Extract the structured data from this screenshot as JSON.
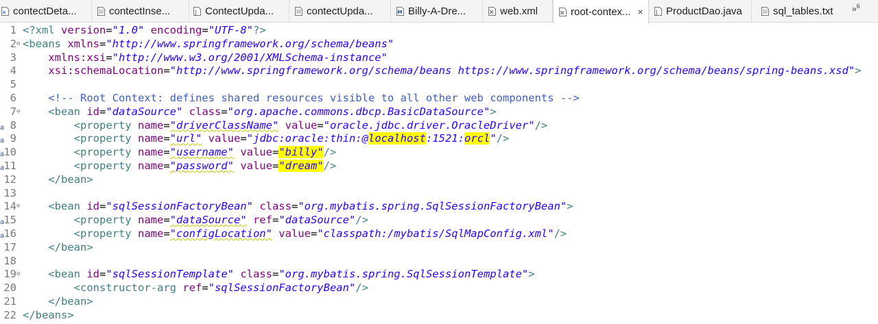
{
  "tabs": [
    {
      "label": "contectDeta...",
      "icon": "xml-file-icon",
      "active": false
    },
    {
      "label": "contectInse...",
      "icon": "text-file-icon",
      "active": false
    },
    {
      "label": "ContectUpda...",
      "icon": "java-file-icon",
      "active": false
    },
    {
      "label": "contectUpda...",
      "icon": "text-file-icon",
      "active": false
    },
    {
      "label": "Billy-A-Dre...",
      "icon": "manifest-file-icon",
      "active": false
    },
    {
      "label": "web.xml",
      "icon": "xml-file-icon",
      "active": false
    },
    {
      "label": "root-contex...",
      "icon": "xml-file-icon",
      "active": true
    },
    {
      "label": "ProductDao.java",
      "icon": "java-file-icon",
      "active": false
    },
    {
      "label": "sql_tables.txt",
      "icon": "text-file-icon",
      "active": false
    }
  ],
  "tab_close": "×",
  "overflow": {
    "arrows": "»",
    "count": "6"
  },
  "lines": [
    {
      "n": "1",
      "fold": "",
      "mark": "",
      "tokens": [
        [
          "pi",
          "<?xml "
        ],
        [
          "at",
          "version"
        ],
        [
          "",
          "="
        ],
        [
          "st",
          "\"1.0\""
        ],
        [
          "at",
          " encoding"
        ],
        [
          "",
          "="
        ],
        [
          "st",
          "\"UTF-8\""
        ],
        [
          "pi",
          "?>"
        ]
      ]
    },
    {
      "n": "2",
      "fold": "⊖",
      "mark": "",
      "tokens": [
        [
          "tg",
          "<beans "
        ],
        [
          "at",
          "xmlns"
        ],
        [
          "",
          "="
        ],
        [
          "st",
          "\"http://www.springframework.org/schema/beans\""
        ]
      ]
    },
    {
      "n": "3",
      "fold": "",
      "mark": "",
      "tokens": [
        [
          "at",
          "    xmlns:xsi"
        ],
        [
          "",
          "="
        ],
        [
          "st",
          "\"http://www.w3.org/2001/XMLSchema-instance\""
        ]
      ]
    },
    {
      "n": "4",
      "fold": "",
      "mark": "",
      "tokens": [
        [
          "at",
          "    xsi:schemaLocation"
        ],
        [
          "",
          "="
        ],
        [
          "st",
          "\"http://www.springframework.org/schema/beans https://www.springframework.org/schema/beans/spring-beans.xsd\""
        ],
        [
          "tg",
          ">"
        ]
      ]
    },
    {
      "n": "5",
      "fold": "",
      "mark": "",
      "tokens": []
    },
    {
      "n": "6",
      "fold": "",
      "mark": "",
      "tokens": [
        [
          "cm",
          "    <!-- Root Context: defines shared resources visible to all other web components -->"
        ]
      ]
    },
    {
      "n": "7",
      "fold": "⊖",
      "mark": "",
      "tokens": [
        [
          "tg",
          "    <bean "
        ],
        [
          "at",
          "id"
        ],
        [
          "",
          "="
        ],
        [
          "st",
          "\"dataSource\""
        ],
        [
          "at",
          " class"
        ],
        [
          "",
          "="
        ],
        [
          "st",
          "\"org.apache.commons.dbcp.BasicDataSource\""
        ],
        [
          "tg",
          ">"
        ]
      ]
    },
    {
      "n": "8",
      "fold": "",
      "mark": "a",
      "tokens": [
        [
          "tg",
          "        <property "
        ],
        [
          "at",
          "name"
        ],
        [
          "",
          "="
        ],
        [
          "st sq",
          "\"driverClassName\""
        ],
        [
          "at",
          " value"
        ],
        [
          "",
          "="
        ],
        [
          "st",
          "\"oracle.jdbc.driver.OracleDriver\""
        ],
        [
          "tg",
          "/>"
        ]
      ]
    },
    {
      "n": "9",
      "fold": "",
      "mark": "a",
      "tokens": [
        [
          "tg",
          "        <property "
        ],
        [
          "at",
          "name"
        ],
        [
          "",
          "="
        ],
        [
          "st sq",
          "\"url\""
        ],
        [
          "at",
          " value"
        ],
        [
          "",
          "="
        ],
        [
          "st",
          "\"jdbc:oracle:thin:@"
        ],
        [
          "st hl",
          "localhost"
        ],
        [
          "st",
          ":1521:"
        ],
        [
          "st hl",
          "orcl"
        ],
        [
          "st",
          "\""
        ],
        [
          "tg",
          "/>"
        ]
      ]
    },
    {
      "n": "10",
      "fold": "",
      "mark": "a",
      "tokens": [
        [
          "tg",
          "        <property "
        ],
        [
          "at",
          "name"
        ],
        [
          "",
          "="
        ],
        [
          "st sq",
          "\"username\""
        ],
        [
          "at",
          " value"
        ],
        [
          "",
          "="
        ],
        [
          "st hl",
          "\"billy\""
        ],
        [
          "tg",
          "/>"
        ]
      ]
    },
    {
      "n": "11",
      "fold": "",
      "mark": "a",
      "tokens": [
        [
          "tg",
          "        <property "
        ],
        [
          "at",
          "name"
        ],
        [
          "",
          "="
        ],
        [
          "st sq",
          "\"password\""
        ],
        [
          "at",
          " value"
        ],
        [
          "",
          "="
        ],
        [
          "st hl",
          "\"dream\""
        ],
        [
          "tg",
          "/>"
        ]
      ]
    },
    {
      "n": "12",
      "fold": "",
      "mark": "",
      "tokens": [
        [
          "tg",
          "    </bean>"
        ]
      ]
    },
    {
      "n": "13",
      "fold": "",
      "mark": "",
      "tokens": []
    },
    {
      "n": "14",
      "fold": "⊖",
      "mark": "",
      "tokens": [
        [
          "tg",
          "    <bean "
        ],
        [
          "at",
          "id"
        ],
        [
          "",
          "="
        ],
        [
          "st",
          "\"sqlSessionFactoryBean\""
        ],
        [
          "at",
          " class"
        ],
        [
          "",
          "="
        ],
        [
          "st",
          "\"org.mybatis.spring.SqlSessionFactoryBean\""
        ],
        [
          "tg",
          ">"
        ]
      ]
    },
    {
      "n": "15",
      "fold": "",
      "mark": "a",
      "tokens": [
        [
          "tg",
          "        <property "
        ],
        [
          "at",
          "name"
        ],
        [
          "",
          "="
        ],
        [
          "st sq",
          "\"dataSource\""
        ],
        [
          "at",
          " ref"
        ],
        [
          "",
          "="
        ],
        [
          "st",
          "\"dataSource\""
        ],
        [
          "tg",
          "/>"
        ]
      ]
    },
    {
      "n": "16",
      "fold": "",
      "mark": "a",
      "tokens": [
        [
          "tg",
          "        <property "
        ],
        [
          "at",
          "name"
        ],
        [
          "",
          "="
        ],
        [
          "st sq",
          "\"configLocation\""
        ],
        [
          "at",
          " value"
        ],
        [
          "",
          "="
        ],
        [
          "st",
          "\"classpath:/mybatis/SqlMapConfig.xml\""
        ],
        [
          "tg",
          "/>"
        ]
      ]
    },
    {
      "n": "17",
      "fold": "",
      "mark": "",
      "tokens": [
        [
          "tg",
          "    </bean>"
        ]
      ]
    },
    {
      "n": "18",
      "fold": "",
      "mark": "",
      "tokens": []
    },
    {
      "n": "19",
      "fold": "⊖",
      "mark": "",
      "tokens": [
        [
          "tg",
          "    <bean "
        ],
        [
          "at",
          "id"
        ],
        [
          "",
          "="
        ],
        [
          "st",
          "\"sqlSessionTemplate\""
        ],
        [
          "at",
          " class"
        ],
        [
          "",
          "="
        ],
        [
          "st",
          "\"org.mybatis.spring.SqlSessionTemplate\""
        ],
        [
          "tg",
          ">"
        ]
      ]
    },
    {
      "n": "20",
      "fold": "",
      "mark": "",
      "tokens": [
        [
          "tg",
          "        <constructor-arg "
        ],
        [
          "at",
          "ref"
        ],
        [
          "",
          "="
        ],
        [
          "st",
          "\"sqlSessionFactoryBean\""
        ],
        [
          "tg",
          "/>"
        ]
      ]
    },
    {
      "n": "21",
      "fold": "",
      "mark": "",
      "tokens": [
        [
          "tg",
          "    </bean>"
        ]
      ]
    },
    {
      "n": "22",
      "fold": "",
      "mark": "",
      "tokens": [
        [
          "tg",
          "</beans>"
        ]
      ]
    }
  ]
}
